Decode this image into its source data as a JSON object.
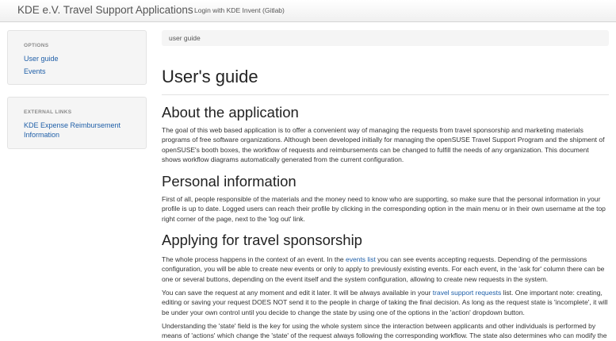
{
  "navbar": {
    "brand": "KDE e.V. Travel Support Applications",
    "login": "Login with KDE Invent (Gitlab)"
  },
  "sidebar": {
    "options": {
      "header": "OPTIONS",
      "items": [
        {
          "label": "User guide"
        },
        {
          "label": "Events"
        }
      ]
    },
    "external": {
      "header": "EXTERNAL LINKS",
      "items": [
        {
          "label_line1": "KDE Expense Reimbursement",
          "label_line2": "Information"
        }
      ]
    }
  },
  "breadcrumb": {
    "current": "user guide"
  },
  "main": {
    "title": "User's guide",
    "sections": [
      {
        "heading": "About the application",
        "paragraphs": [
          {
            "text": "The goal of this web based application is to offer a convenient way of managing the requests from travel sponsorship and marketing materials programs of free software organizations. Although been developed initially for managing the openSUSE Travel Support Program and the shipment of openSUSE's booth boxes, the workflow of requests and reimbursements can be changed to fulfill the needs of any organization. This document shows workflow diagrams automatically generated from the current configuration."
          }
        ]
      },
      {
        "heading": "Personal information",
        "paragraphs": [
          {
            "text": "First of all, people responsible of the materials and the money need to know who are supporting, so make sure that the personal information in your profile is up to date. Logged users can reach their profile by clicking in the corresponding option in the main menu or in their own username at the top right corner of the page, next to the 'log out' link."
          }
        ]
      },
      {
        "heading": "Applying for travel sponsorship",
        "paragraphs": [
          {
            "before": "The whole process happens in the context of an event. In the ",
            "link": "events list",
            "after": " you can see events accepting requests. Depending of the permissions configuration, you will be able to create new events or only to apply to previously existing events. For each event, in the 'ask for' column there can be one or several buttons, depending on the event itself and the system configuration, allowing to create new requests in the system."
          },
          {
            "before": "You can save the request at any moment and edit it later. It will be always available in your ",
            "link": "travel support requests",
            "after": " list. One important note: creating, editing or saving your request DOES NOT send it to the people in charge of taking the final decision. As long as the request state is 'incomplete', it will be under your own control until you decide to change the state by using one of the options in the 'action' dropdown button."
          },
          {
            "text": "Understanding the 'state' field is the key for using the whole system since the interaction between applicants and other individuals is performed by means of 'actions' which change the 'state' of the request always following the corresponding workflow. The state also determines who can modify the"
          }
        ]
      }
    ]
  }
}
